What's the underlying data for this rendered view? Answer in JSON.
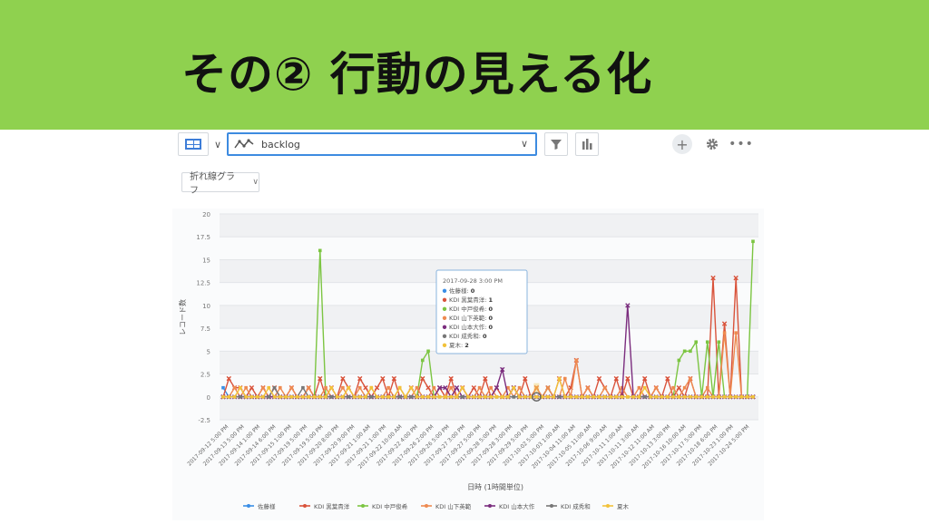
{
  "banner": {
    "title": "その② 行動の見える化"
  },
  "toolbar": {
    "search_value": "backlog",
    "chevron": "∨",
    "dropdown_arrow": "∨",
    "plus_label": "+",
    "more_label": "•••"
  },
  "chart_type_select": {
    "value": "折れ線グラフ",
    "arrow": "∨"
  },
  "icons": [
    "table-grid-icon",
    "line-chart-icon",
    "filter-icon",
    "bar-chart-icon",
    "plus-icon",
    "gear-icon",
    "more-icon"
  ],
  "colors": {
    "banner": "#8fd14f",
    "accent_blue": "#3d8be0"
  },
  "chart_data": {
    "type": "line",
    "ylabel": "レコード数",
    "xlabel": "日時 (1時間単位)",
    "ylim": [
      -2.5,
      20
    ],
    "yticks": [
      "20",
      "17.5",
      "15",
      "12.5",
      "10",
      "7.5",
      "5",
      "2.5",
      "0",
      "-2.5"
    ],
    "xticks": [
      "2017-09-12 5:00 PM",
      "2017-09-13 5:00 PM",
      "2017-09-14 1:00 PM",
      "2017-09-14 6:00 PM",
      "2017-09-15 1:00 PM",
      "2017-09-19 5:00 PM",
      "2017-09-19 5:00 PM",
      "2017-09-20 8:00 PM",
      "2017-09-20 9:00 PM",
      "2017-09-21 1:00 AM",
      "2017-09-21 1:00 PM",
      "2017-09-22 10:00 AM",
      "2017-09-22 4:00 PM",
      "2017-09-26 2:00 PM",
      "2017-09-26 5:00 PM",
      "2017-09-27 3:00 PM",
      "2017-09-27 5:00 PM",
      "2017-09-28 5:00 PM",
      "2017-09-28 3:00 PM",
      "2017-09-29 5:00 PM",
      "2017-10-02 5:00 PM",
      "2017-10-03 1:00 AM",
      "2017-10-04 11:00 AM",
      "2017-10-05 11:00 AM",
      "2017-10-06 9:00 AM",
      "2017-10-11 1:00 AM",
      "2017-10-11 3:00 AM",
      "2017-10-12 11:00 AM",
      "2017-10-13 3:00 PM",
      "2017-10-16 10:00 AM",
      "2017-10-17 5:00 PM",
      "2017-10-18 6:00 PM",
      "2017-10-23 1:00 PM",
      "2017-10-24 5:00 PM"
    ],
    "legend_position": "bottom",
    "grid": true,
    "series": [
      {
        "name": "佐藤様",
        "color": "#3a8ee6",
        "values": [
          1,
          0,
          0,
          0,
          0,
          0,
          0,
          0,
          0,
          0,
          0,
          0,
          0,
          0,
          0,
          0,
          0,
          0,
          0,
          0,
          0,
          0,
          0,
          0,
          0,
          0,
          0,
          0,
          0,
          0,
          0,
          0,
          0,
          0,
          0,
          0,
          0,
          0,
          0,
          0,
          0,
          0,
          0,
          0,
          0,
          0,
          0,
          0,
          0,
          0,
          0,
          0,
          0,
          0,
          0,
          0,
          0,
          0,
          0,
          0,
          0,
          0,
          0,
          0,
          0,
          0,
          0,
          0,
          0,
          0,
          0,
          0,
          0,
          0,
          0,
          0,
          0,
          0,
          0,
          0,
          0,
          0,
          0,
          0,
          0,
          0,
          0,
          0,
          0,
          0,
          0,
          0,
          0,
          0
        ]
      },
      {
        "name": "KDI 黒葉貴洋",
        "color": "#d9533b",
        "values": [
          0,
          2,
          1,
          1,
          0,
          1,
          0,
          1,
          0,
          1,
          0,
          0,
          1,
          0,
          0,
          1,
          0,
          2,
          0,
          1,
          0,
          2,
          1,
          0,
          2,
          1,
          0,
          1,
          2,
          0,
          2,
          0,
          0,
          1,
          0,
          2,
          1,
          0,
          1,
          0,
          2,
          0,
          1,
          0,
          1,
          0,
          2,
          0,
          1,
          0,
          0,
          1,
          0,
          2,
          0,
          1,
          0,
          1,
          0,
          2,
          0,
          1,
          4,
          0,
          1,
          0,
          2,
          1,
          0,
          2,
          0,
          2,
          0,
          0,
          2,
          0,
          1,
          0,
          2,
          0,
          1,
          0,
          2,
          0,
          0,
          0,
          13,
          0,
          8,
          0,
          13,
          0,
          0,
          0
        ]
      },
      {
        "name": "KDI 中戸俊希",
        "color": "#7cc542",
        "values": [
          0,
          0,
          0,
          0,
          0,
          0,
          0,
          0,
          0,
          0,
          0,
          0,
          0,
          0,
          0,
          0,
          0,
          16,
          0,
          0,
          0,
          0,
          0,
          0,
          0,
          0,
          0,
          0,
          0,
          0,
          0,
          0,
          0,
          0,
          0,
          4,
          5,
          0,
          0,
          0,
          0,
          0,
          0,
          0,
          0,
          0,
          0,
          0,
          0,
          0,
          0,
          0,
          0,
          0,
          0,
          0,
          0,
          1,
          0,
          0,
          0,
          0,
          0,
          0,
          0,
          0,
          0,
          0,
          0,
          0,
          0,
          0,
          0,
          0,
          0,
          0,
          0,
          0,
          0,
          0,
          4,
          5,
          5,
          6,
          0,
          6,
          0,
          6,
          0,
          0,
          0,
          0,
          0,
          17
        ]
      },
      {
        "name": "KDI 山下英範",
        "color": "#ee8a50",
        "values": [
          0,
          0,
          1,
          0,
          1,
          0,
          0,
          1,
          0,
          0,
          1,
          0,
          1,
          0,
          0,
          1,
          0,
          0,
          1,
          0,
          0,
          1,
          0,
          0,
          1,
          0,
          1,
          0,
          0,
          1,
          0,
          1,
          0,
          0,
          1,
          0,
          0,
          1,
          0,
          0,
          1,
          0,
          1,
          0,
          0,
          1,
          0,
          1,
          0,
          0,
          1,
          0,
          1,
          0,
          0,
          1,
          0,
          1,
          0,
          0,
          2,
          0,
          4,
          0,
          1,
          0,
          0,
          1,
          0,
          0,
          1,
          0,
          0,
          1,
          0,
          0,
          1,
          0,
          0,
          1,
          0,
          1,
          2,
          0,
          0,
          1,
          0,
          0,
          7,
          0,
          7,
          0,
          0,
          0
        ]
      },
      {
        "name": "KDI 山本大作",
        "color": "#7b2d7e",
        "values": [
          0,
          0,
          0,
          0,
          0,
          0,
          0,
          0,
          0,
          0,
          0,
          0,
          0,
          0,
          0,
          0,
          0,
          0,
          0,
          0,
          0,
          0,
          0,
          0,
          0,
          0,
          0,
          0,
          0,
          0,
          0,
          0,
          0,
          0,
          0,
          0,
          0,
          0,
          1,
          1,
          0,
          1,
          0,
          0,
          0,
          0,
          0,
          0,
          1,
          3,
          0,
          1,
          0,
          0,
          0,
          0,
          0,
          0,
          0,
          0,
          0,
          0,
          0,
          0,
          0,
          0,
          0,
          0,
          0,
          0,
          0,
          10,
          0,
          0,
          0,
          0,
          0,
          0,
          0,
          0,
          0,
          0,
          0,
          0,
          0,
          0,
          0,
          0,
          0,
          0,
          0,
          0,
          0,
          0
        ]
      },
      {
        "name": "KDI 成秀和",
        "color": "#777777",
        "values": [
          0,
          0,
          0,
          0,
          0,
          0,
          0,
          0,
          0,
          1,
          0,
          0,
          0,
          0,
          1,
          0,
          0,
          0,
          0,
          0,
          0,
          0,
          0,
          0,
          0,
          0,
          0,
          0,
          0,
          0,
          0,
          0,
          0,
          0,
          0,
          0,
          0,
          0,
          0,
          0,
          0,
          0,
          0,
          0,
          0,
          0,
          0,
          0,
          0,
          0,
          0,
          0,
          0,
          0,
          0,
          0,
          0,
          0,
          0,
          0,
          0,
          0,
          0,
          0,
          0,
          0,
          0,
          0,
          0,
          0,
          0,
          0,
          0,
          0,
          0,
          0,
          0,
          0,
          0,
          0,
          0,
          0,
          0,
          0,
          0,
          0,
          0,
          0,
          0,
          0,
          0,
          0,
          0,
          0
        ]
      },
      {
        "name": "夏木",
        "color": "#f2c23a",
        "values": [
          0,
          0,
          0,
          1,
          0,
          0,
          0,
          0,
          1,
          0,
          0,
          0,
          0,
          0,
          0,
          0,
          0,
          0,
          0,
          1,
          0,
          0,
          1,
          0,
          0,
          0,
          1,
          0,
          0,
          0,
          0,
          1,
          0,
          1,
          0,
          0,
          0,
          0,
          0,
          0,
          0,
          0,
          1,
          0,
          0,
          0,
          0,
          0,
          0,
          0,
          0,
          1,
          0,
          0,
          0,
          0,
          0,
          0,
          0,
          2,
          0,
          0,
          0,
          0,
          0,
          0,
          0,
          0,
          0,
          0,
          0,
          0,
          0,
          0,
          1,
          0,
          0,
          0,
          0,
          0,
          0,
          0,
          0,
          0,
          0,
          0,
          0,
          0,
          0,
          0,
          0,
          0,
          0,
          0
        ]
      }
    ],
    "tooltip": {
      "title": "2017-09-28 3:00 PM",
      "rows": [
        {
          "label": "佐藤様",
          "value": "0",
          "color": "#3a8ee6"
        },
        {
          "label": "KDI 黒葉貴洋",
          "value": "1",
          "color": "#d9533b"
        },
        {
          "label": "KDI 中戸俊希",
          "value": "0",
          "color": "#7cc542"
        },
        {
          "label": "KDI 山下英範",
          "value": "0",
          "color": "#ee8a50"
        },
        {
          "label": "KDI 山本大作",
          "value": "0",
          "color": "#7b2d7e"
        },
        {
          "label": "KDI 成秀和",
          "value": "0",
          "color": "#777777"
        },
        {
          "label": "夏木",
          "value": "2",
          "color": "#f2c23a"
        }
      ]
    }
  }
}
